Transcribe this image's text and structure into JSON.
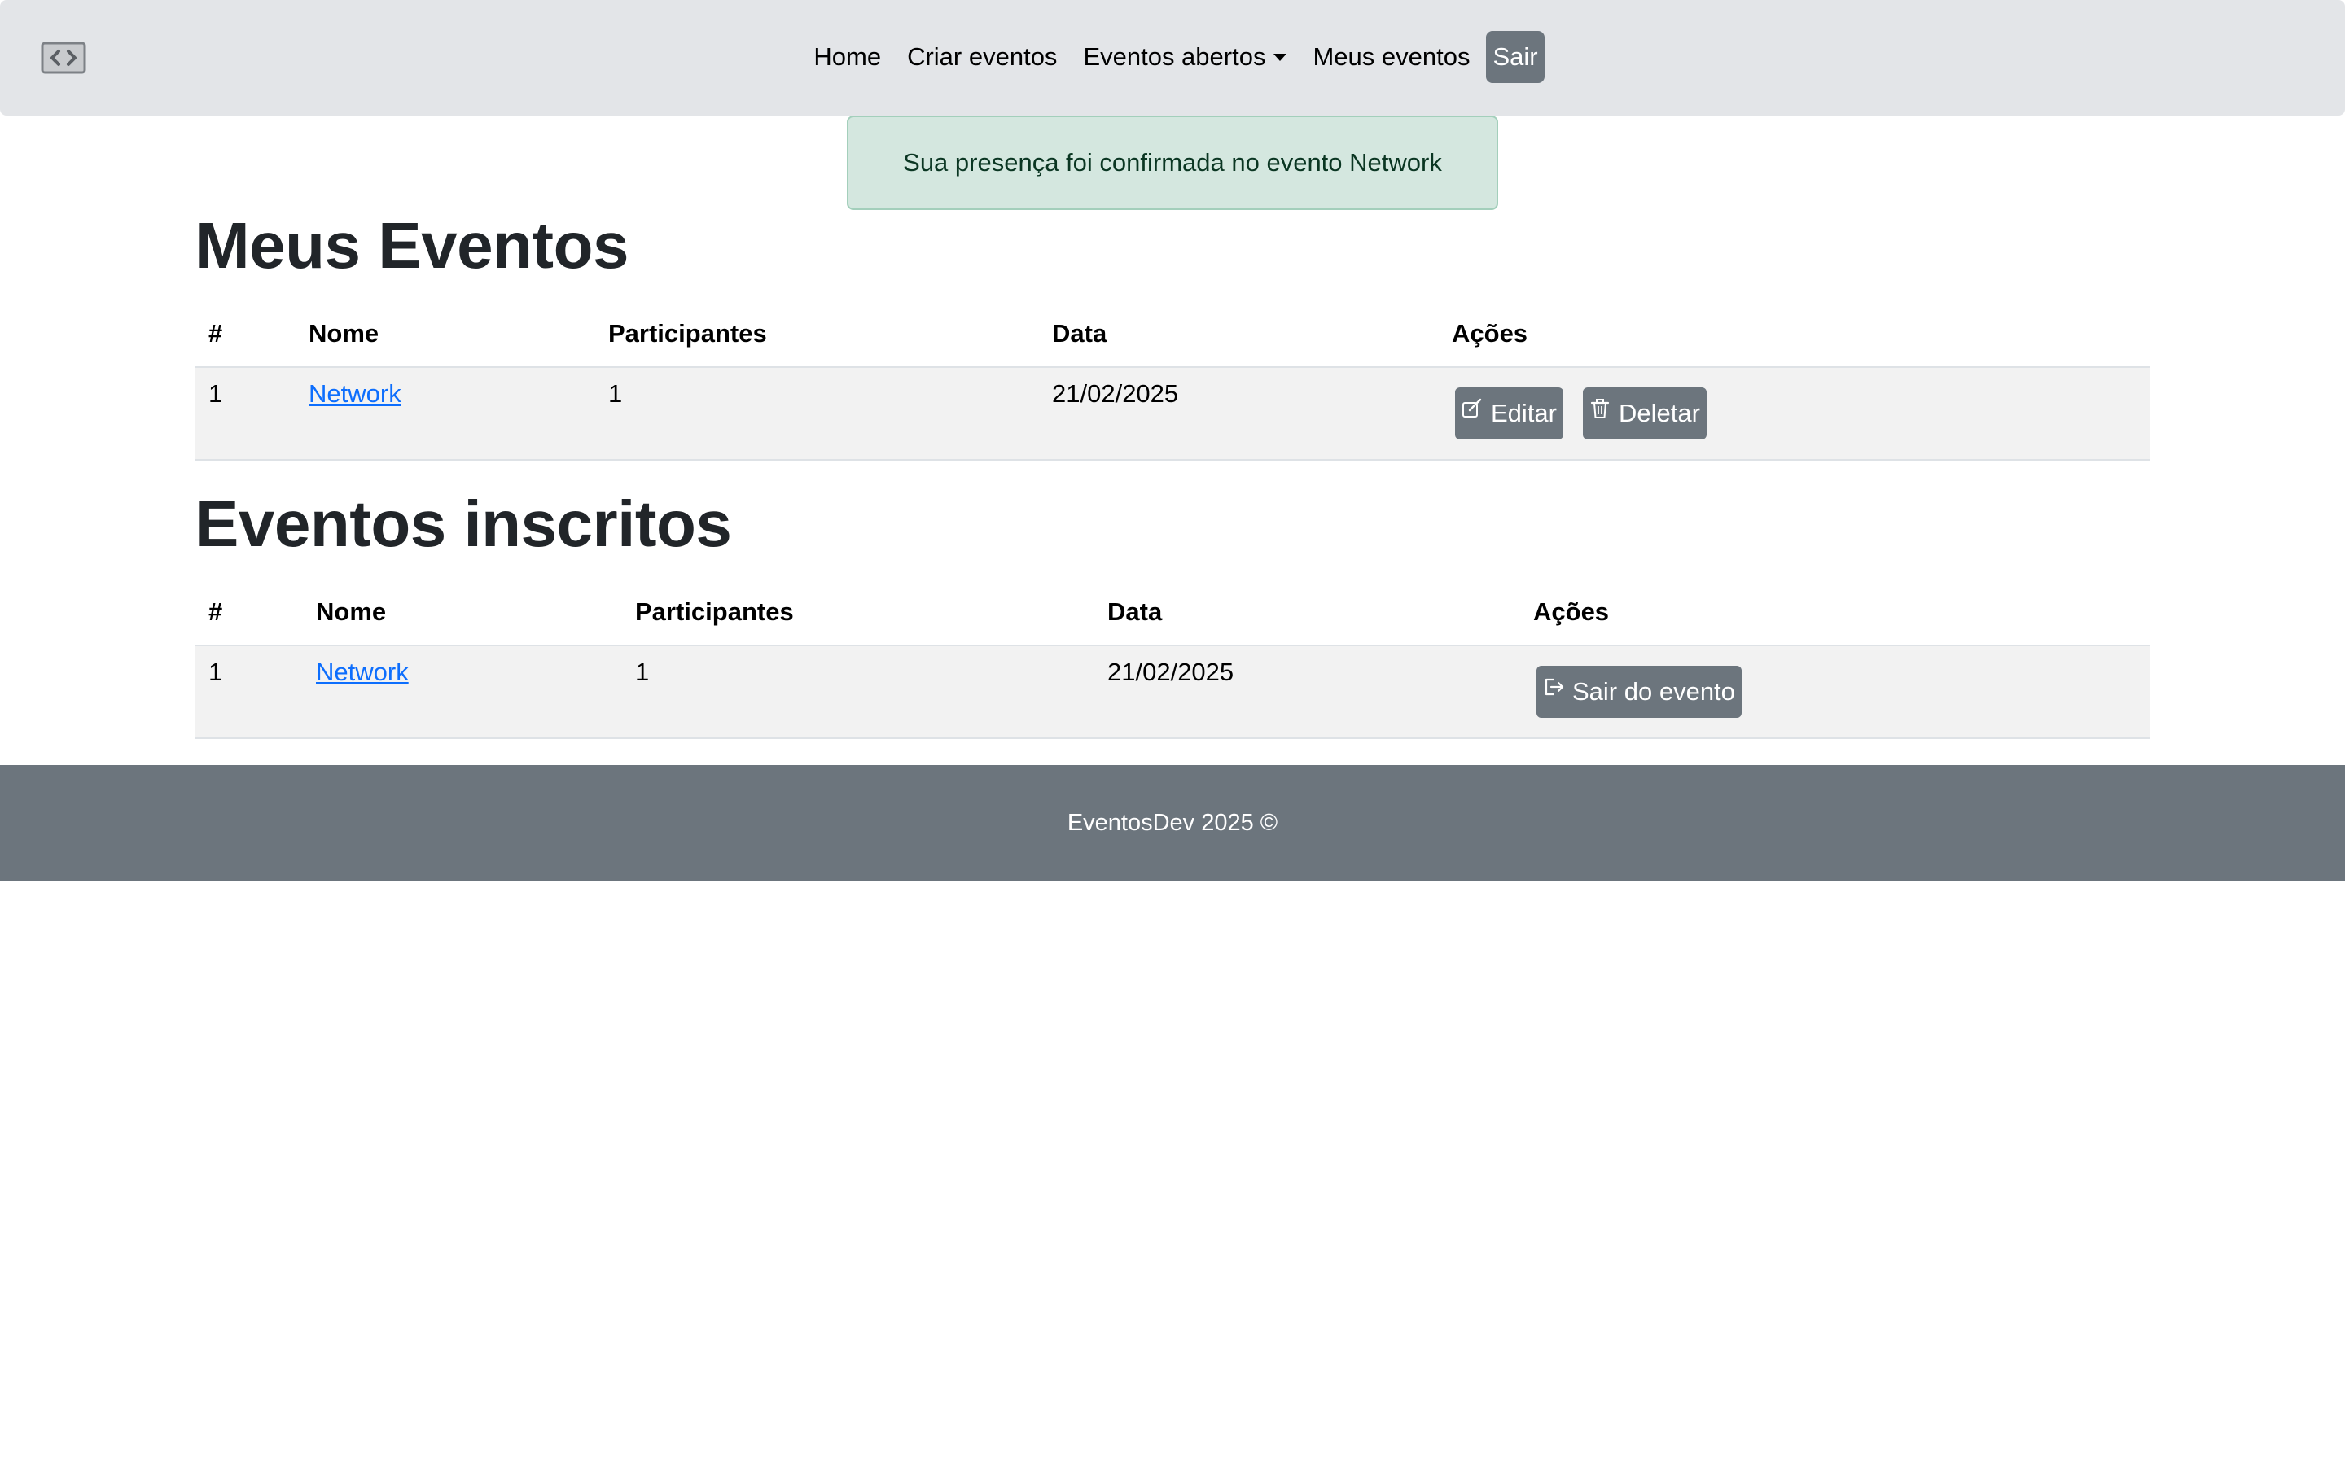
{
  "nav": {
    "brand_icon": "code-window-icon",
    "links": [
      "Home",
      "Criar eventos",
      "Eventos abertos",
      "Meus eventos"
    ],
    "logout": "Sair"
  },
  "alert": {
    "message": "Sua presença foi confirmada no evento Network",
    "color": "#d4e7df"
  },
  "my_events": {
    "title": "Meus Eventos",
    "columns": [
      "#",
      "Nome",
      "Participantes",
      "Data",
      "Ações"
    ],
    "rows": [
      {
        "id": "1",
        "name": "Network",
        "participants": "1",
        "date": "21/02/2025"
      }
    ],
    "actions": {
      "edit": "Editar",
      "delete": "Deletar"
    }
  },
  "subscribed_events": {
    "title": "Eventos inscritos",
    "columns": [
      "#",
      "Nome",
      "Participantes",
      "Data",
      "Ações"
    ],
    "rows": [
      {
        "id": "1",
        "name": "Network",
        "participants": "1",
        "date": "21/02/2025"
      }
    ],
    "actions": {
      "leave": "Sair do evento"
    }
  },
  "footer": {
    "text": "EventosDev 2025 ©"
  },
  "colors": {
    "navbar": "#e3e5e8",
    "button": "#6c757d",
    "link": "#0d6efd",
    "footer": "#6c757d"
  }
}
